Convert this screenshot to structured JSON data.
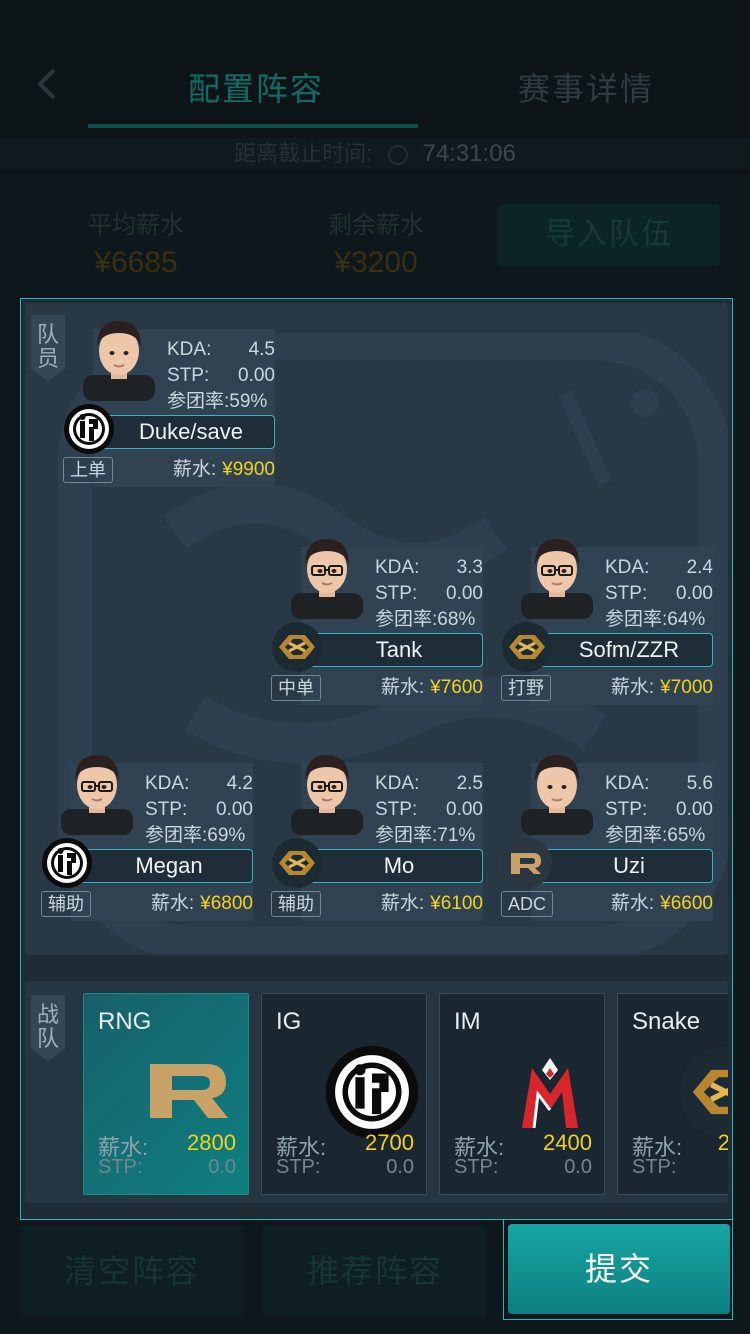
{
  "header": {
    "back_icon": "chevron-left-icon",
    "tabs": [
      {
        "label": "配置阵容",
        "active": true
      },
      {
        "label": "赛事详情",
        "active": false
      }
    ],
    "deadline_label": "距离截止时间:",
    "deadline_time": "74:31:06"
  },
  "summary": {
    "avg_salary_label": "平均薪水",
    "avg_salary_value": "¥6685",
    "remaining_salary_label": "剩余薪水",
    "remaining_salary_value": "¥3200",
    "import_button": "导入队伍"
  },
  "players_panel": {
    "label": "队员",
    "players": [
      {
        "name": "Duke/save",
        "kda_label": "KDA:",
        "kda": "4.5",
        "stp_label": "STP:",
        "stp": "0.00",
        "participation": "参团率:59%",
        "role": "上单",
        "salary_label": "薪水:",
        "salary": "¥9900",
        "team_logo": "ig-logo"
      },
      {
        "name": "Tank",
        "kda_label": "KDA:",
        "kda": "3.3",
        "stp_label": "STP:",
        "stp": "0.00",
        "participation": "参团率:68%",
        "role": "中单",
        "salary_label": "薪水:",
        "salary": "¥7600",
        "team_logo": "snake-logo"
      },
      {
        "name": "Sofm/ZZR",
        "kda_label": "KDA:",
        "kda": "2.4",
        "stp_label": "STP:",
        "stp": "0.00",
        "participation": "参团率:64%",
        "role": "打野",
        "salary_label": "薪水:",
        "salary": "¥7000",
        "team_logo": "snake-logo"
      },
      {
        "name": "Megan",
        "kda_label": "KDA:",
        "kda": "4.2",
        "stp_label": "STP:",
        "stp": "0.00",
        "participation": "参团率:69%",
        "role": "辅助",
        "salary_label": "薪水:",
        "salary": "¥6800",
        "team_logo": "ig-logo"
      },
      {
        "name": "Mo",
        "kda_label": "KDA:",
        "kda": "2.5",
        "stp_label": "STP:",
        "stp": "0.00",
        "participation": "参团率:71%",
        "role": "辅助",
        "salary_label": "薪水:",
        "salary": "¥6100",
        "team_logo": "snake-logo"
      },
      {
        "name": "Uzi",
        "kda_label": "KDA:",
        "kda": "5.6",
        "stp_label": "STP:",
        "stp": "0.00",
        "participation": "参团率:65%",
        "role": "ADC",
        "salary_label": "薪水:",
        "salary": "¥6600",
        "team_logo": "rng-logo"
      }
    ]
  },
  "teams_panel": {
    "label": "战队",
    "teams": [
      {
        "name": "RNG",
        "salary_label": "薪水:",
        "salary": "2800",
        "stp_label": "STP:",
        "stp": "0.0",
        "selected": true,
        "logo": "rng-logo"
      },
      {
        "name": "IG",
        "salary_label": "薪水:",
        "salary": "2700",
        "stp_label": "STP:",
        "stp": "0.0",
        "selected": false,
        "logo": "ig-logo"
      },
      {
        "name": "IM",
        "salary_label": "薪水:",
        "salary": "2400",
        "stp_label": "STP:",
        "stp": "0.0",
        "selected": false,
        "logo": "im-logo"
      },
      {
        "name": "Snake",
        "salary_label": "薪水:",
        "salary": "2",
        "stp_label": "STP:",
        "stp": "",
        "selected": false,
        "logo": "snake-logo"
      }
    ]
  },
  "footer": {
    "clear_button": "清空阵容",
    "recommend_button": "推荐阵容",
    "submit_button": "提交"
  },
  "colors": {
    "accent_teal": "#0f8a88",
    "salary_yellow": "#f3d21b",
    "panel_bg": "#283845",
    "border_cyan": "#2fb3bd"
  }
}
